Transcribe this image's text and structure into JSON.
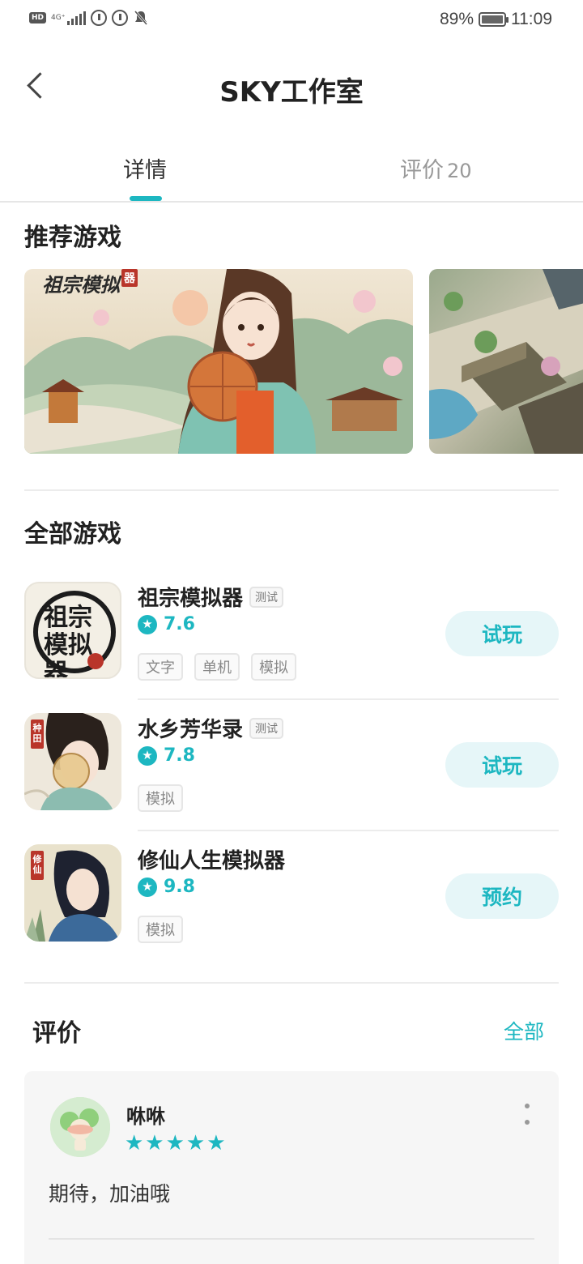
{
  "status_bar": {
    "network": "4G⁺",
    "battery": "89%",
    "time": "11:09"
  },
  "header": {
    "title": "SKY工作室"
  },
  "tabs": [
    {
      "label": "详情",
      "active": true
    },
    {
      "label": "评价",
      "count": "20",
      "active": false
    }
  ],
  "recommended": {
    "title": "推荐游戏",
    "banners": [
      {
        "logo_text": "祖宗模拟",
        "seal": "器"
      },
      {
        "logo_text": ""
      }
    ]
  },
  "all_games": {
    "title": "全部游戏",
    "items": [
      {
        "name": "祖宗模拟器",
        "badge": "测试",
        "rating": "7.6",
        "tags": [
          "文字",
          "单机",
          "模拟"
        ],
        "action": "试玩",
        "icon_text": "祖宗模拟器"
      },
      {
        "name": "水乡芳华录",
        "badge": "测试",
        "rating": "7.8",
        "tags": [
          "模拟"
        ],
        "action": "试玩",
        "icon_text": "种田"
      },
      {
        "name": "修仙人生模拟器",
        "badge": "",
        "rating": "9.8",
        "tags": [
          "模拟"
        ],
        "action": "预约",
        "icon_text": "修仙"
      }
    ]
  },
  "reviews": {
    "title": "评价",
    "all_label": "全部",
    "items": [
      {
        "user": "咻咻",
        "stars": "★★★★★",
        "rating": 5,
        "text": "期待，加油哦"
      }
    ]
  },
  "colors": {
    "accent": "#1db7c1",
    "button_bg": "#e6f6f8"
  }
}
